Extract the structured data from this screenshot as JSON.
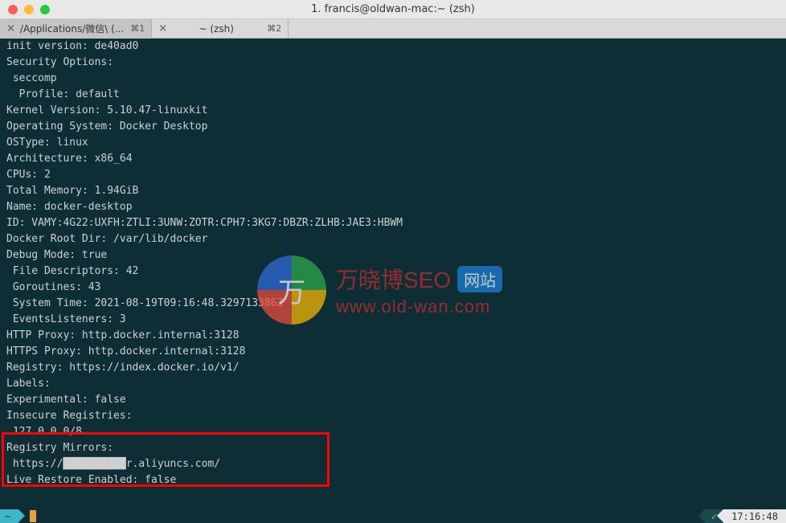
{
  "window": {
    "title": "1. francis@oldwan-mac:~ (zsh)"
  },
  "tabs": [
    {
      "label": "/Applications/微信\\ (...",
      "shortcut": "⌘1",
      "active": true
    },
    {
      "label": "~ (zsh)",
      "shortcut": "⌘2",
      "active": false
    }
  ],
  "terminal_lines": [
    "init version: de40ad0",
    "Security Options:",
    " seccomp",
    "  Profile: default",
    "Kernel Version: 5.10.47-linuxkit",
    "Operating System: Docker Desktop",
    "OSType: linux",
    "Architecture: x86_64",
    "CPUs: 2",
    "Total Memory: 1.94GiB",
    "Name: docker-desktop",
    "ID: VAMY:4G22:UXFH:ZTLI:3UNW:ZOTR:CPH7:3KG7:DBZR:ZLHB:JAE3:HBWM",
    "Docker Root Dir: /var/lib/docker",
    "Debug Mode: true",
    " File Descriptors: 42",
    " Goroutines: 43",
    " System Time: 2021-08-19T09:16:48.329713386Z",
    " EventsListeners: 3",
    "HTTP Proxy: http.docker.internal:3128",
    "HTTPS Proxy: http.docker.internal:3128",
    "Registry: https://index.docker.io/v1/",
    "Labels:",
    "Experimental: false",
    "Insecure Registries:",
    " 127.0.0.0/8",
    "Registry Mirrors:",
    " https://██████████r.aliyuncs.com/",
    "Live Restore Enabled: false"
  ],
  "watermark": {
    "symbol": "万",
    "cn_text": "万晓博SEO",
    "badge": "网站",
    "url": "www.old-wan.com"
  },
  "statusbar": {
    "prompt": "~",
    "check": "✓",
    "time": "17:16:48"
  }
}
